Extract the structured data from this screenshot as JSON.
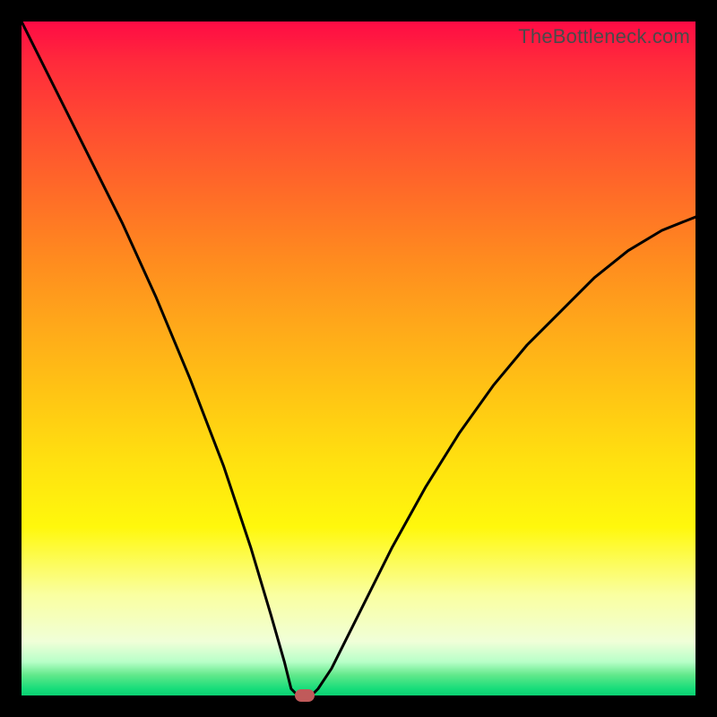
{
  "watermark": "TheBottleneck.com",
  "colors": {
    "frame": "#000000",
    "gradient_top": "#ff0b45",
    "gradient_mid": "#ffe010",
    "gradient_bottom": "#0bd072",
    "curve": "#000000",
    "marker": "#c05a5a"
  },
  "chart_data": {
    "type": "line",
    "title": "",
    "xlabel": "",
    "ylabel": "",
    "xlim": [
      0,
      100
    ],
    "ylim": [
      0,
      100
    ],
    "grid": false,
    "legend": false,
    "description": "Bottleneck curve: y is high (bad) at both x extremes and drops to ~0 near x≈42 (optimal point). Background is a vertical heat gradient from red (top, high bottleneck) to green (bottom, no bottleneck).",
    "x": [
      0,
      5,
      10,
      15,
      20,
      25,
      30,
      34,
      37,
      39,
      40,
      41,
      42,
      43,
      44,
      46,
      50,
      55,
      60,
      65,
      70,
      75,
      80,
      85,
      90,
      95,
      100
    ],
    "values": [
      100,
      90,
      80,
      70,
      59,
      47,
      34,
      22,
      12,
      5,
      1,
      0,
      0,
      0,
      1,
      4,
      12,
      22,
      31,
      39,
      46,
      52,
      57,
      62,
      66,
      69,
      71
    ],
    "marker": {
      "x": 42,
      "y": 0
    }
  }
}
